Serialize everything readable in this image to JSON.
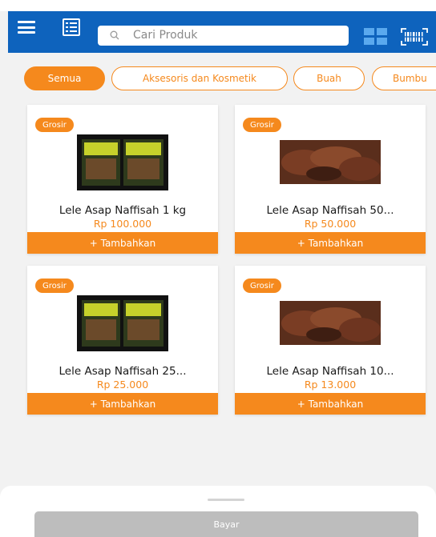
{
  "header": {
    "search_placeholder": "Cari Produk",
    "icons": [
      "menu-icon",
      "list-icon",
      "search-icon",
      "grid-view-icon",
      "barcode-scan-icon"
    ],
    "bar_color": "#0e63bd"
  },
  "categories": [
    {
      "label": "Semua",
      "active": true
    },
    {
      "label": "Aksesoris dan Kosmetik",
      "active": false
    },
    {
      "label": "Buah",
      "active": false
    },
    {
      "label": "Bumbu",
      "active": false
    }
  ],
  "products": [
    {
      "badge": "Grosir",
      "name": "Lele Asap Naffisah 1 kg",
      "price": "Rp 100.000",
      "action": "+ Tambahkan"
    },
    {
      "badge": "Grosir",
      "name": "Lele Asap Naffisah 50...",
      "price": "Rp 50.000",
      "action": "+ Tambahkan"
    },
    {
      "badge": "Grosir",
      "name": "Lele Asap Naffisah 25...",
      "price": "Rp 25.000",
      "action": "+ Tambahkan"
    },
    {
      "badge": "Grosir",
      "name": "Lele Asap Naffisah 10...",
      "price": "Rp 13.000",
      "action": "+ Tambahkan"
    }
  ],
  "footer": {
    "pay_label": "Bayar"
  },
  "colors": {
    "accent": "#f5891d",
    "primary": "#0e63bd",
    "disabled": "#bdbdbd"
  }
}
